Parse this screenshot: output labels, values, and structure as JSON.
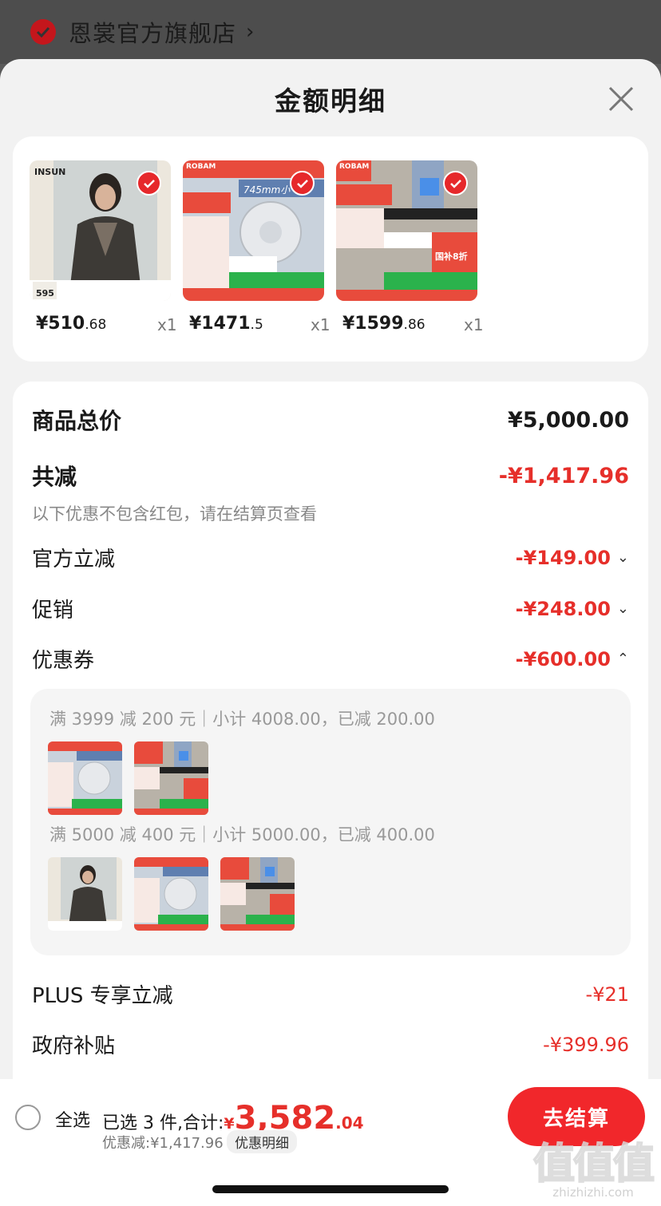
{
  "store": {
    "name": "恩裳官方旗舰店",
    "chevron": "›"
  },
  "sheet": {
    "title": "金额明细"
  },
  "products": [
    {
      "price_main": "¥510",
      "price_dec": ".68",
      "qty": "x1",
      "brand": "INSUN",
      "tag": "595"
    },
    {
      "price_main": "¥1471",
      "price_dec": ".5",
      "qty": "x1",
      "brand": "ROBAM",
      "tag": "745mm小"
    },
    {
      "price_main": "¥1599",
      "price_dec": ".86",
      "qty": "x1",
      "brand": "ROBAM",
      "tag": "国补8折"
    }
  ],
  "details": {
    "total_label": "商品总价",
    "total_value": "¥5,000.00",
    "reduce_label": "共减",
    "reduce_value": "-¥1,417.96",
    "reduce_note": "以下优惠不包含红包，请在结算页查看",
    "official_label": "官方立减",
    "official_value": "-¥149.00",
    "promo_label": "促销",
    "promo_value": "-¥248.00",
    "coupon_label": "优惠券",
    "coupon_value": "-¥600.00",
    "coupon_line1": "满 3999 减 200 元｜小计 4008.00，已减 200.00",
    "coupon_line2": "满 5000 减 400 元｜小计 5000.00，已减 400.00",
    "plus_label": "PLUS 专享立减",
    "plus_value": "-¥21",
    "gov_label": "政府补贴",
    "gov_value": "-¥399.96"
  },
  "bottom": {
    "select_all": "全选",
    "selected_text": "已选 3 件,合计:",
    "yen": "¥",
    "total_int": "3,582",
    "total_dec": ".04",
    "discount_text": "优惠减:¥1,417.96",
    "detail_link": "优惠明细",
    "checkout": "去结算"
  },
  "watermark": {
    "glyph": "值值值",
    "text": "zhizhizhi.com"
  },
  "colors": {
    "accent_red": "#e62f2a",
    "checkout_red": "#f1272b",
    "brand_red": "#c4161c"
  },
  "icons": [
    "check-icon",
    "close-icon",
    "chevron-down-icon",
    "chevron-up-icon"
  ]
}
